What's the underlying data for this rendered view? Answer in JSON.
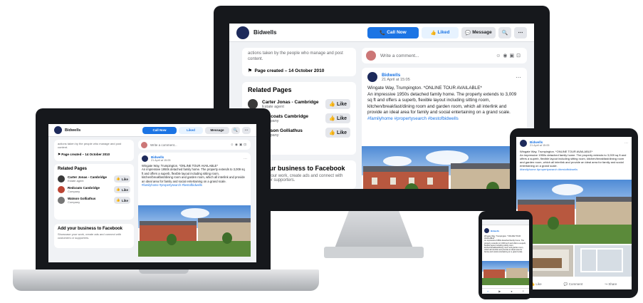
{
  "page": {
    "name": "Bidwells",
    "call_label": "Call Now",
    "liked_label": "Liked",
    "message_label": "Message",
    "search_icon": "search-icon",
    "more_icon": "more-icon"
  },
  "about": {
    "actions_text": "actions taken by the people who manage and post content.",
    "page_created": "Page created – 14 October 2010"
  },
  "related": {
    "heading": "Related Pages",
    "items": [
      {
        "name": "Carter Jonas - Cambridge",
        "category": "Estate agent"
      },
      {
        "name": "Redcoats Cambridge",
        "category": "Company"
      },
      {
        "name": "Watson Golliathus",
        "category": "Company"
      }
    ],
    "like_label": "Like"
  },
  "promo": {
    "heading": "Add your business to Facebook",
    "text": "Showcase your work, create ads and connect with customers or supporters.",
    "heading_short": "r business to Facebook",
    "text_short": "work, create ads and connect with r supporters."
  },
  "comment": {
    "placeholder": "Write a comment..."
  },
  "post": {
    "author": "Bidwells",
    "time": "21 April at 15:05",
    "line1": "Wingate Way, Trumpington. *ONLINE TOUR AVAILABLE*",
    "body": "An impressive 1950s detached family home. The property extends to 3,009 sq ft and offers a superb, flexible layout including sitting room, kitchen/breakfast/dining room and garden room, which all interlink and provide an ideal area for family and social entertaining on a grand scale.",
    "hashtags": "#familyhome #propertysearch #bestofbidwells"
  },
  "reactions": {
    "like": "Like",
    "comment": "Comment",
    "share": "Share"
  },
  "colors": {
    "brand": "#1b74e4",
    "logo": "#1d2a5b",
    "bg": "#f0f2f5"
  }
}
